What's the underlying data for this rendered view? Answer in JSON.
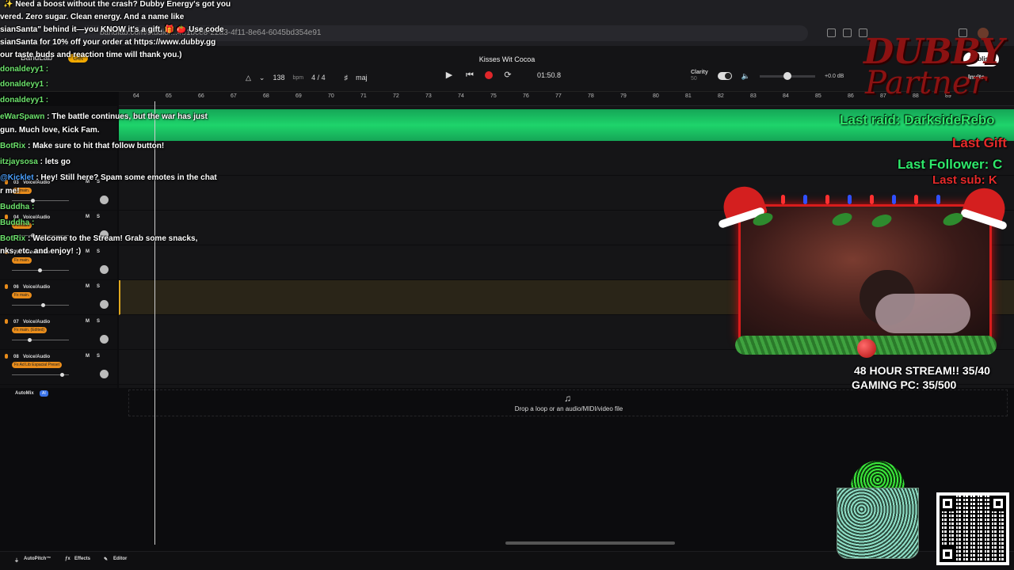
{
  "browser": {
    "address": "bandlab.com/studio/...4b1bce8-22a3-4f11-8e64-6045bd354e91"
  },
  "app": {
    "logo": "BandLab",
    "get_badge": "Get",
    "song_title": "Kisses Wit Cocoa",
    "bpm": "138",
    "bpm_unit": "bpm",
    "time_signature": "4 / 4",
    "key": "maj",
    "timecode": "01:50.8",
    "clarity_label": "Clarity",
    "clarity_value": "50",
    "volume_db": "+0.0 dB",
    "publish": "Publish",
    "invite": "Invite"
  },
  "ruler": [
    "64",
    "65",
    "66",
    "67",
    "68",
    "69",
    "70",
    "71",
    "72",
    "73",
    "74",
    "75",
    "76",
    "77",
    "78",
    "79",
    "80",
    "81",
    "82",
    "83",
    "84",
    "85",
    "86",
    "87",
    "88",
    "89"
  ],
  "tracks": [
    {
      "num": "03",
      "name": "Voice/Audio",
      "fx": "Fx main.",
      "m": "M",
      "s": "S",
      "slider": 0.35
    },
    {
      "num": "04",
      "name": "Voice/Audio",
      "fx": "Fx main.",
      "m": "M",
      "s": "S",
      "slider": 0.35
    },
    {
      "num": "05",
      "name": "Voice/Audio",
      "fx": "Fx main.",
      "m": "M",
      "s": "S",
      "slider": 0.48
    },
    {
      "num": "06",
      "name": "Voice/Audio",
      "fx": "Fx main.",
      "m": "M",
      "s": "S",
      "slider": 0.55
    },
    {
      "num": "07",
      "name": "Voice/Audio",
      "fx": "Fx main. (Edited)",
      "m": "M",
      "s": "S",
      "slider": 0.3
    },
    {
      "num": "08",
      "name": "Voice/Audio",
      "fx": "Fx Ad Lib Espacial Preset",
      "m": "M",
      "s": "S",
      "slider": 0.9
    }
  ],
  "automix": {
    "label": "AutoMix",
    "ai": "AI"
  },
  "drop": {
    "text": "Drop a loop or an audio/MIDI/video file"
  },
  "bottom": {
    "autopitch": "AutoPitch™",
    "effects": "Effects",
    "editor": "Editor"
  },
  "overlay": {
    "promo_line1": "✨ Need a boost without the crash? Dubby Energy's got you",
    "promo_line2": "vered. Zero sugar. Clean energy. And a name like",
    "promo_line3": "sianSanta\" behind it—you KNOW it's a gift. 🎁 🍅 Use code",
    "promo_line4": "sianSanta for 10% off your order at https://www.dubby.gg",
    "promo_line5": "our taste buds and reaction time will thank you.)",
    "chat": [
      {
        "user": "donaldeyy1 :",
        "text": ""
      },
      {
        "user": "donaldeyy1 :",
        "text": ""
      },
      {
        "user": "donaldeyy1 :",
        "text": ""
      },
      {
        "user": "eWarSpawn",
        "text": ": The battle continues, but the war has just"
      },
      {
        "user": "",
        "text": "gun. Much love, Kick Fam."
      },
      {
        "user": "BotRix",
        "text": ": Make sure to hit that follow button!"
      },
      {
        "user": "itzjaysosa",
        "text": ": lets go"
      },
      {
        "user": "@Kicklet",
        "text": ": Hey! Still here? Spam some emotes in the chat"
      },
      {
        "user": "",
        "text": "r me!"
      },
      {
        "user": "Buddha :",
        "text": ""
      },
      {
        "user": "Buddha :",
        "text": ""
      },
      {
        "user": "BotRix",
        "text": ": Welcome to the Stream! Grab some snacks,"
      },
      {
        "user": "",
        "text": "nks, etc. and enjoy! :)"
      }
    ],
    "brand1": "DUBBY",
    "brand2": "Partner",
    "last_raid": "Last raid: DarksideRebo",
    "last_gift": "Last Gift",
    "last_follower": "Last Follower: C",
    "last_sub": "Last sub: K",
    "stream_goal": "48 HOUR STREAM!! 35/40",
    "pc_goal": "GAMING PC: 35/500"
  }
}
